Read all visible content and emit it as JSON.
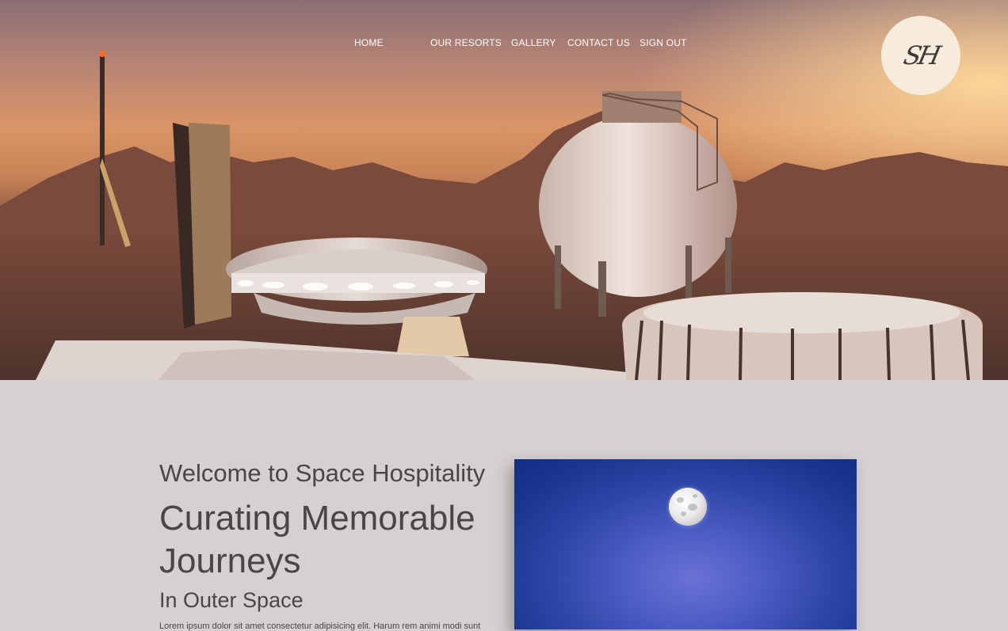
{
  "nav": {
    "links": [
      "HOME",
      "OUR RESORTS",
      "GALLERY",
      "CONTACT US",
      "SIGN OUT"
    ]
  },
  "logo": {
    "text": "SH"
  },
  "hero": {
    "image_description_icon": "mars-base-landscape"
  },
  "intro": {
    "welcome": "Welcome to Space Hospitality",
    "headline": "Curating Memorable Journeys",
    "subhead": "In Outer Space",
    "body": "Lorem ipsum dolor sit amet consectetur adipisicing elit. Harum rem animi modi sunt"
  },
  "colors": {
    "page_background": "#d5d0d1",
    "text": "#4a4646",
    "logo_badge": "#f7ebdc",
    "nav_text": "#ffffff",
    "moon_sky": "#2f46a8"
  }
}
